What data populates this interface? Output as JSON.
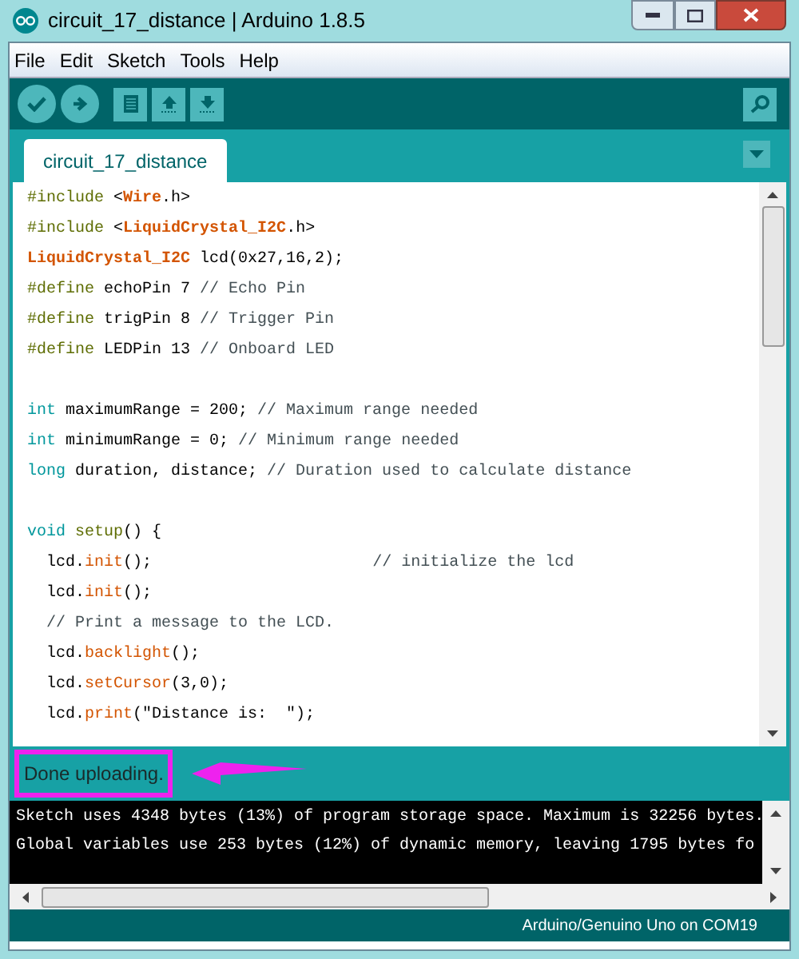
{
  "window": {
    "title": "circuit_17_distance | Arduino 1.8.5"
  },
  "menu": [
    "File",
    "Edit",
    "Sketch",
    "Tools",
    "Help"
  ],
  "toolbar": {
    "buttons": [
      {
        "kind": "verify"
      },
      {
        "kind": "upload"
      },
      {
        "kind": "new"
      },
      {
        "kind": "open"
      },
      {
        "kind": "save"
      }
    ]
  },
  "tabs": [
    {
      "label": "circuit_17_distance",
      "selected": true
    }
  ],
  "editor": {
    "lines": [
      {
        "kind": "code",
        "tokens": [
          {
            "kind": "directive",
            "text": "#include "
          },
          {
            "kind": "plain",
            "text": "<"
          },
          {
            "kind": "class",
            "text": "Wire"
          },
          {
            "kind": "plain",
            "text": ".h>"
          }
        ]
      },
      {
        "kind": "code",
        "tokens": [
          {
            "kind": "directive",
            "text": "#include "
          },
          {
            "kind": "plain",
            "text": "<"
          },
          {
            "kind": "class",
            "text": "LiquidCrystal_I2C"
          },
          {
            "kind": "plain",
            "text": ".h>"
          }
        ]
      },
      {
        "kind": "code",
        "tokens": [
          {
            "kind": "class",
            "text": "LiquidCrystal_I2C"
          },
          {
            "kind": "plain",
            "text": " lcd(0x27,16,2);"
          }
        ]
      },
      {
        "kind": "code",
        "tokens": [
          {
            "kind": "directive",
            "text": "#define "
          },
          {
            "kind": "plain",
            "text": "echoPin 7 "
          },
          {
            "kind": "comment",
            "text": "// Echo Pin"
          }
        ]
      },
      {
        "kind": "code",
        "tokens": [
          {
            "kind": "directive",
            "text": "#define "
          },
          {
            "kind": "plain",
            "text": "trigPin 8 "
          },
          {
            "kind": "comment",
            "text": "// Trigger Pin"
          }
        ]
      },
      {
        "kind": "code",
        "tokens": [
          {
            "kind": "directive",
            "text": "#define "
          },
          {
            "kind": "plain",
            "text": "LEDPin 13 "
          },
          {
            "kind": "comment",
            "text": "// Onboard LED"
          }
        ]
      },
      {
        "kind": "blank"
      },
      {
        "kind": "code",
        "tokens": [
          {
            "kind": "type",
            "text": "int"
          },
          {
            "kind": "plain",
            "text": " maximumRange = 200; "
          },
          {
            "kind": "comment",
            "text": "// Maximum range needed"
          }
        ]
      },
      {
        "kind": "code",
        "tokens": [
          {
            "kind": "type",
            "text": "int"
          },
          {
            "kind": "plain",
            "text": " minimumRange = 0; "
          },
          {
            "kind": "comment",
            "text": "// Minimum range needed"
          }
        ]
      },
      {
        "kind": "code",
        "tokens": [
          {
            "kind": "type",
            "text": "long"
          },
          {
            "kind": "plain",
            "text": " duration, distance; "
          },
          {
            "kind": "comment",
            "text": "// Duration used to calculate distance"
          }
        ]
      },
      {
        "kind": "blank"
      },
      {
        "kind": "code",
        "tokens": [
          {
            "kind": "type",
            "text": "void "
          },
          {
            "kind": "directive",
            "text": "setup"
          },
          {
            "kind": "plain",
            "text": "() {"
          }
        ]
      },
      {
        "kind": "code",
        "tokens": [
          {
            "kind": "plain",
            "text": "  lcd."
          },
          {
            "kind": "method",
            "text": "init"
          },
          {
            "kind": "plain",
            "text": "();                       "
          },
          {
            "kind": "comment",
            "text": "// initialize the lcd"
          }
        ]
      },
      {
        "kind": "code",
        "tokens": [
          {
            "kind": "plain",
            "text": "  lcd."
          },
          {
            "kind": "method",
            "text": "init"
          },
          {
            "kind": "plain",
            "text": "();"
          }
        ]
      },
      {
        "kind": "code",
        "tokens": [
          {
            "kind": "comment",
            "text": "  // Print a message to the LCD."
          }
        ]
      },
      {
        "kind": "code",
        "tokens": [
          {
            "kind": "plain",
            "text": "  lcd."
          },
          {
            "kind": "method",
            "text": "backlight"
          },
          {
            "kind": "plain",
            "text": "();"
          }
        ]
      },
      {
        "kind": "code",
        "tokens": [
          {
            "kind": "plain",
            "text": "  lcd."
          },
          {
            "kind": "method",
            "text": "setCursor"
          },
          {
            "kind": "plain",
            "text": "(3,0);"
          }
        ]
      },
      {
        "kind": "code",
        "tokens": [
          {
            "kind": "plain",
            "text": "  lcd."
          },
          {
            "kind": "method",
            "text": "print"
          },
          {
            "kind": "plain",
            "text": "(\"Distance is:  \");"
          }
        ]
      }
    ]
  },
  "status": {
    "message": "Done uploading."
  },
  "console": {
    "lines": [
      "Sketch uses 4348 bytes (13%) of program storage space. Maximum is 32256 bytes.",
      "Global variables use 253 bytes (12%) of dynamic memory, leaving 1795 bytes fo"
    ]
  },
  "status_bar": {
    "board": "Arduino/Genuino Uno on COM19"
  }
}
